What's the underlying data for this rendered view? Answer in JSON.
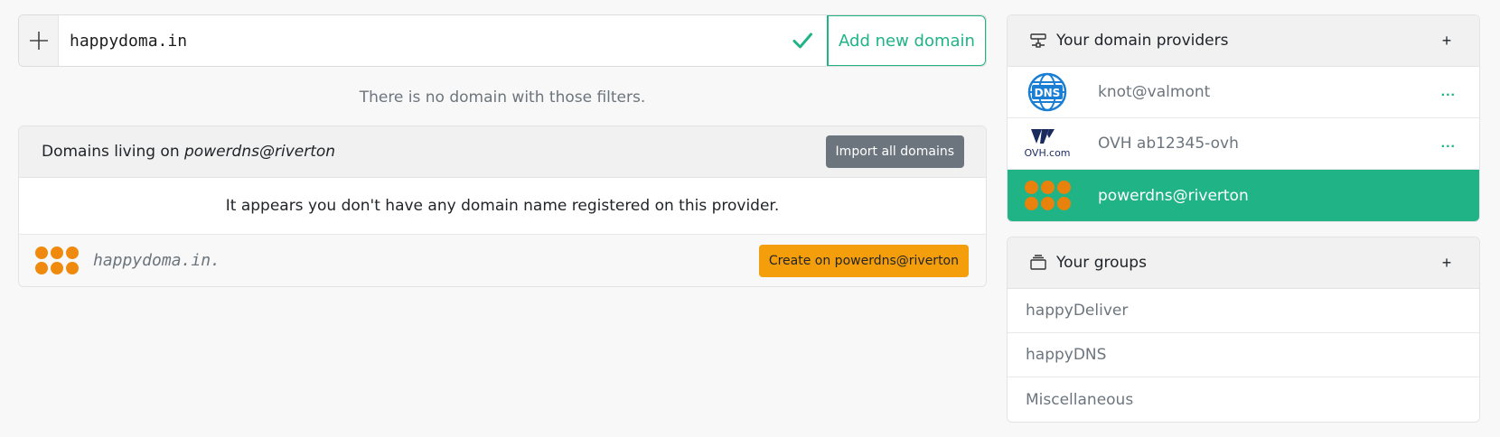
{
  "add_domain": {
    "input_value": "happydoma.in",
    "button_label": "Add new domain"
  },
  "filter_message": "There is no domain with those filters.",
  "provider_card": {
    "title_prefix": "Domains living on ",
    "title_provider": "powerdns@riverton",
    "import_label": "Import all domains",
    "empty_message": "It appears you don't have any domain name registered on this provider.",
    "suggested_domain": "happydoma.in.",
    "create_label": "Create on powerdns@riverton"
  },
  "providers_panel": {
    "title": "Your domain providers",
    "add_label": "+",
    "items": [
      {
        "name": "knot@valmont",
        "logo": "dns-globe-icon",
        "more": "..."
      },
      {
        "name": "OVH ab12345-ovh",
        "logo": "ovh-logo",
        "more": "...",
        "logo_text": "OVH.com"
      },
      {
        "name": "powerdns@riverton",
        "logo": "powerdns-logo",
        "active": true
      }
    ],
    "dns_logo_text": "DNS"
  },
  "groups_panel": {
    "title": "Your groups",
    "add_label": "+",
    "items": [
      "happyDeliver",
      "happyDNS",
      "Miscellaneous"
    ]
  },
  "colors": {
    "accent": "#1fb386",
    "warning": "#f59e0b",
    "secondary": "#6c757d",
    "powerdns_orange": "#f08a0e",
    "dns_blue": "#1a7fd4"
  }
}
